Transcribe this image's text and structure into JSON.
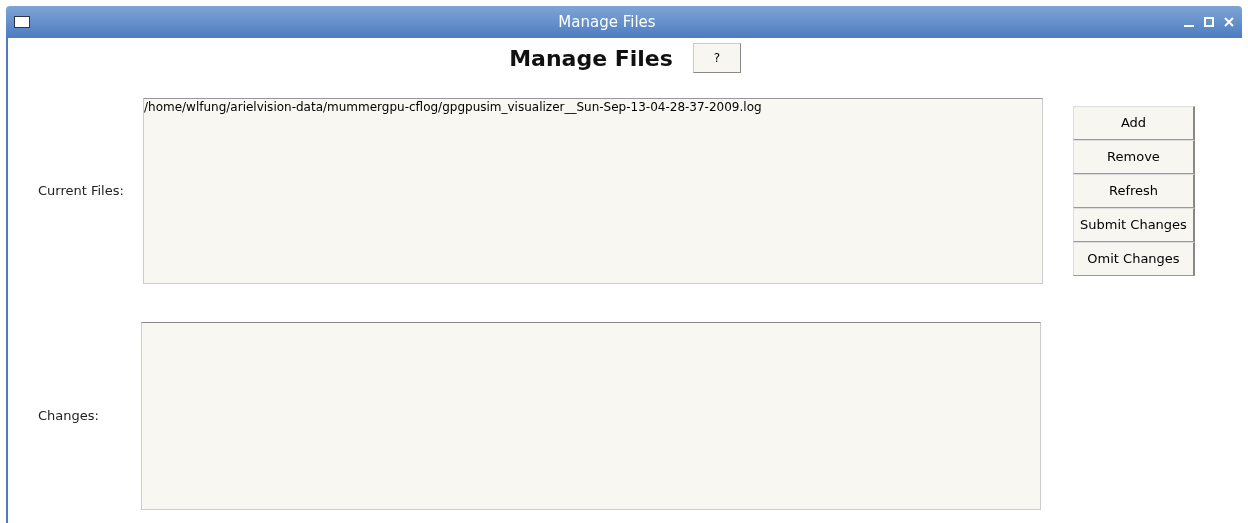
{
  "window": {
    "title": "Manage Files"
  },
  "heading": "Manage Files",
  "help_button": "?",
  "current_files": {
    "label": "Current Files:",
    "items": [
      "/home/wlfung/arielvision-data/mummergpu-cflog/gpgpusim_visualizer__Sun-Sep-13-04-28-37-2009.log"
    ]
  },
  "changes": {
    "label": "Changes:"
  },
  "buttons": [
    "Add",
    "Remove",
    "Refresh",
    "Submit Changes",
    "Omit Changes"
  ]
}
